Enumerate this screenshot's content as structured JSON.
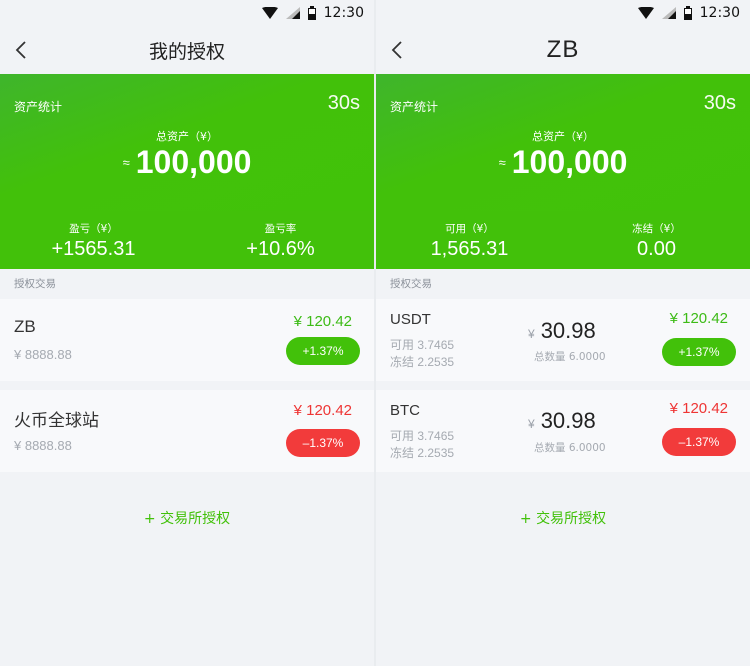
{
  "status": {
    "time": "12:30"
  },
  "left": {
    "title": "我的授权",
    "hero": {
      "label": "资产统计",
      "timer": "30s",
      "total_label": "总资产（¥）",
      "approx": "≈",
      "total": "100,000",
      "col1_label": "盈亏（¥）",
      "col1_value": "+1565.31",
      "col2_label": "盈亏率",
      "col2_value": "+10.6%"
    },
    "section": "授权交易",
    "cards": [
      {
        "name": "ZB",
        "sub": "¥ 8888.88",
        "price": "¥ 120.42",
        "change": "+1.37%"
      },
      {
        "name": "火币全球站",
        "sub": "¥ 8888.88",
        "price": "¥ 120.42",
        "change": "–1.37%"
      }
    ],
    "add": "+ 交易所授权"
  },
  "right": {
    "title": "ZB",
    "hero": {
      "label": "资产统计",
      "timer": "30s",
      "total_label": "总资产（¥）",
      "approx": "≈",
      "total": "100,000",
      "col1_label": "可用（¥）",
      "col1_value": "1,565.31",
      "col2_label": "冻结（¥）",
      "col2_value": "0.00"
    },
    "section": "授权交易",
    "cards": [
      {
        "name": "USDT",
        "avail": "可用 3.7465",
        "frozen": "冻结 2.2535",
        "yen": "¥",
        "amount": "30.98",
        "count": "总数量 6.0000",
        "price": "¥ 120.42",
        "change": "+1.37%"
      },
      {
        "name": "BTC",
        "avail": "可用 3.7465",
        "frozen": "冻结 2.2535",
        "yen": "¥",
        "amount": "30.98",
        "count": "总数量 6.0000",
        "price": "¥ 120.42",
        "change": "–1.37%"
      }
    ],
    "add": "+ 交易所授权"
  },
  "colors": {
    "green": "#42c10a",
    "red": "#f23b3b",
    "background": "#f1f3f6"
  }
}
